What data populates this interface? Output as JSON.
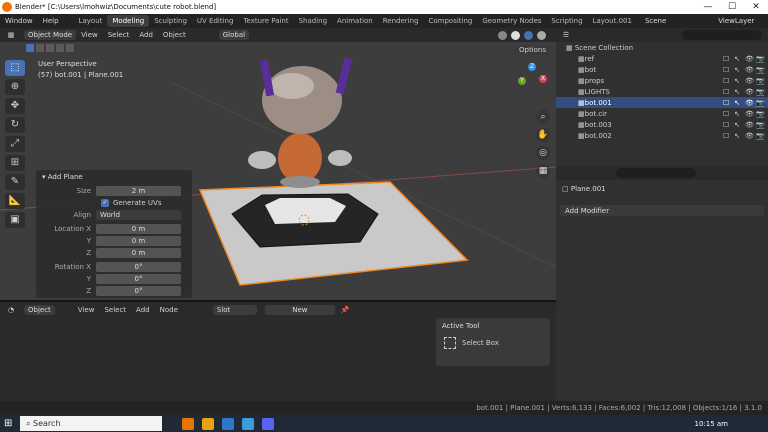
{
  "window": {
    "title": "Blender* [C:\\Users\\lmohwiz\\Documents\\cute robot.blend]",
    "minimize": "—",
    "maximize": "☐",
    "close": "✕"
  },
  "topbar": {
    "menus": [
      "Window",
      "Help"
    ],
    "workspaces": [
      "Layout",
      "Modeling",
      "Sculpting",
      "UV Editing",
      "Texture Paint",
      "Shading",
      "Animation",
      "Rendering",
      "Compositing",
      "Geometry Nodes",
      "Scripting",
      "Layout.001"
    ],
    "active_workspace": "Modeling",
    "scene": "Scene",
    "view_layer": "ViewLayer"
  },
  "viewport_header": {
    "mode": "Object Mode",
    "menus": [
      "View",
      "Select",
      "Add",
      "Object"
    ],
    "transform": "Global",
    "options": "Options"
  },
  "viewport": {
    "perspective": "User Perspective",
    "object_info": "(57) bot.001 | Plane.001",
    "gizmo_axes": [
      "X",
      "Y",
      "Z"
    ]
  },
  "tools": [
    "select-box",
    "cursor",
    "move",
    "rotate",
    "scale",
    "transform",
    "annotate",
    "measure",
    "add-cube"
  ],
  "add_plane": {
    "title": "Add Plane",
    "size_label": "Size",
    "size": "2 m",
    "generate_uvs": "Generate UVs",
    "align_label": "Align",
    "align": "World",
    "location_label": "Location X",
    "loc_y_label": "Y",
    "loc_z_label": "Z",
    "loc_x": "0 m",
    "loc_y": "0 m",
    "loc_z": "0 m",
    "rotation_label": "Rotation X",
    "rot_y_label": "Y",
    "rot_z_label": "Z",
    "rot_x": "0°",
    "rot_y": "0°",
    "rot_z": "0°"
  },
  "bottom_panel": {
    "object": "Object",
    "menus": [
      "View",
      "Select",
      "Add",
      "Node"
    ],
    "slot": "Slot",
    "new_label": "New"
  },
  "active_tool": {
    "title": "Active Tool",
    "tool": "Select Box"
  },
  "outliner": {
    "collection": "Scene Collection",
    "items": [
      {
        "name": "ref",
        "selected": false
      },
      {
        "name": "bot",
        "selected": false
      },
      {
        "name": "props",
        "selected": false
      },
      {
        "name": "LIGHTS",
        "selected": false
      },
      {
        "name": "bot.001",
        "selected": true
      },
      {
        "name": "bot.cir",
        "selected": false
      },
      {
        "name": "bot.003",
        "selected": false
      },
      {
        "name": "bot.002",
        "selected": false
      }
    ]
  },
  "properties": {
    "object": "Plane.001",
    "add_modifier": "Add Modifier"
  },
  "status": {
    "text": "bot.001 | Plane.001 | Verts:6,133 | Faces:6,002 | Tris:12,008 | Objects:1/16 | 3.1.0"
  },
  "taskbar": {
    "search": "Search",
    "time": "10:15 am"
  },
  "colors": {
    "accent": "#4772b3",
    "selection_orange": "#f08a24",
    "viewport_bg": "#3d3d3d"
  }
}
